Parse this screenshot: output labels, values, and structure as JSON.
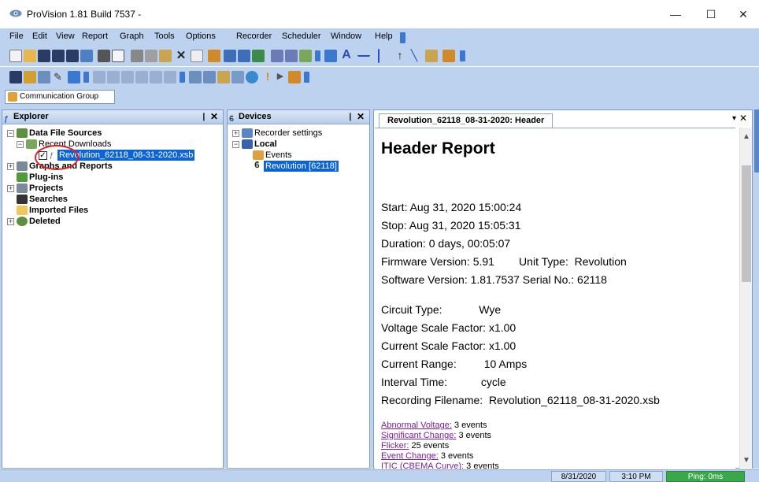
{
  "window": {
    "title": "ProVision 1.81 Build 7537 -",
    "minimize": "—",
    "maximize": "☐",
    "close": "✕"
  },
  "menu": [
    "File",
    "Edit",
    "View",
    "Report",
    "Graph",
    "Tools",
    "Options",
    "Recorder",
    "Scheduler",
    "Window",
    "Help"
  ],
  "comm_group": "Communication Group",
  "explorer": {
    "title": "Explorer",
    "icon": "waveform-icon",
    "pin": "❙",
    "close": "✕",
    "items": [
      {
        "label": "Data File Sources",
        "bold": true
      },
      {
        "label": "Recent Downloads",
        "bold": false
      },
      {
        "label": "Revolution_62118_08-31-2020.xsb",
        "bold": false,
        "selected": true
      },
      {
        "label": "Graphs and Reports",
        "bold": true
      },
      {
        "label": "Plug-ins",
        "bold": true
      },
      {
        "label": "Projects",
        "bold": true
      },
      {
        "label": "Searches",
        "bold": true
      },
      {
        "label": "Imported Files",
        "bold": true
      },
      {
        "label": "Deleted",
        "bold": true
      }
    ]
  },
  "devices": {
    "title": "Devices",
    "pin": "❙",
    "close": "✕",
    "items": [
      {
        "label": "Recorder settings",
        "bold": false
      },
      {
        "label": "Local",
        "bold": true
      },
      {
        "label": "Events",
        "bold": false
      },
      {
        "label": "Revolution [62118]",
        "bold": false,
        "selected": true
      }
    ]
  },
  "document": {
    "tab": "Revolution_62118_08-31-2020: Header",
    "title": "Header Report",
    "lines": [
      "Start: Aug 31, 2020 15:00:24",
      "Stop: Aug 31, 2020 15:05:31",
      "Duration: 0 days, 00:05:07",
      "Firmware Version: 5.91        Unit Type:  Revolution",
      "Software Version:  1.81.7537 Serial No.: 62118",
      "Circuit Type:            Wye",
      "Voltage Scale Factor: x1.00",
      "Current Scale Factor: x1.00",
      "Current Range:         10 Amps",
      "Interval Time:           cycle",
      "Recording Filename:  Revolution_62118_08-31-2020.xsb"
    ],
    "links": [
      {
        "label": "Abnormal Voltage:",
        "value": " 3 events"
      },
      {
        "label": "Significant Change:",
        "value": " 3 events"
      },
      {
        "label": "Flicker:",
        "value": " 25 events"
      },
      {
        "label": "Event Change:",
        "value": " 3 events"
      },
      {
        "label": "ITIC (CBEMA Curve):",
        "value": " 3 events"
      }
    ]
  },
  "status": {
    "date": "8/31/2020",
    "time": "3:10 PM",
    "ping": "Ping: 0ms"
  },
  "colors": {
    "chrome": "#bcd2ee",
    "selection": "#0a64d8",
    "link": "#7a1fa0",
    "ping": "#3aa84a"
  }
}
